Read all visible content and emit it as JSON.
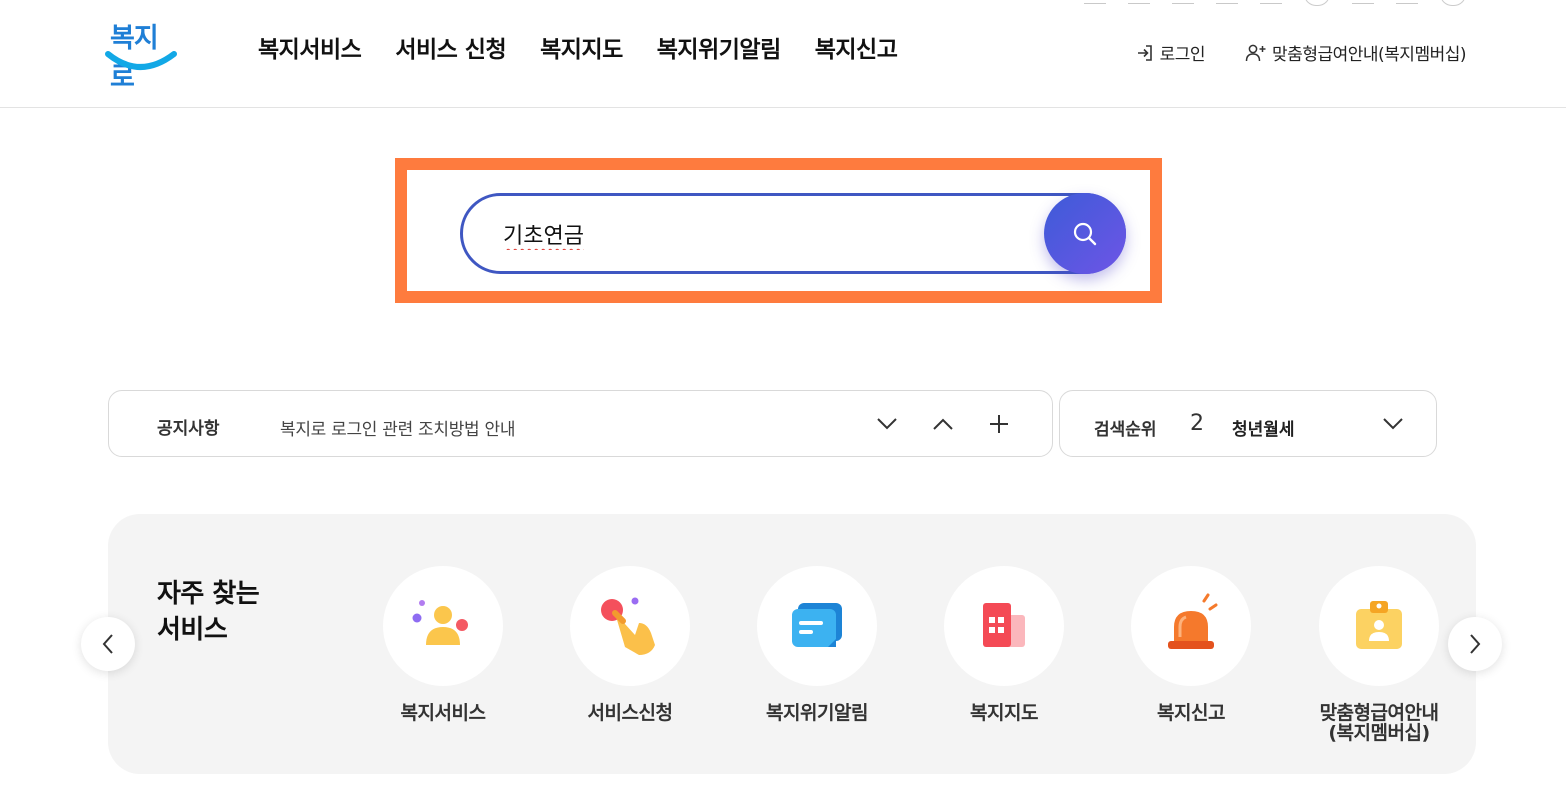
{
  "header": {
    "logo_text": "복지로",
    "nav": [
      "복지서비스",
      "서비스 신청",
      "복지지도",
      "복지위기알림",
      "복지신고"
    ],
    "login_label": "로그인",
    "membership_label": "맞춤형급여안내(복지멤버십)"
  },
  "search": {
    "value": "기초연금",
    "icon": "search-icon"
  },
  "notice": {
    "label": "공지사항",
    "text": "복지로 로그인 관련 조치방법 안내"
  },
  "rank": {
    "label": "검색순위",
    "number": "2",
    "keyword": "청년월세"
  },
  "favorites": {
    "title_line1": "자주 찾는",
    "title_line2": "서비스",
    "items": [
      {
        "label": "복지서비스",
        "icon": "people-icon"
      },
      {
        "label": "서비스신청",
        "icon": "hand-tap-icon"
      },
      {
        "label": "복지위기알림",
        "icon": "message-icon"
      },
      {
        "label": "복지지도",
        "icon": "building-icon"
      },
      {
        "label": "복지신고",
        "icon": "siren-icon"
      },
      {
        "label": "맞춤형급여안내",
        "label2": "(복지멤버십)",
        "icon": "id-badge-icon"
      }
    ]
  },
  "colors": {
    "highlight": "#fe7b3e",
    "search_border": "#3f57c2",
    "search_button": "#4f58dc"
  }
}
